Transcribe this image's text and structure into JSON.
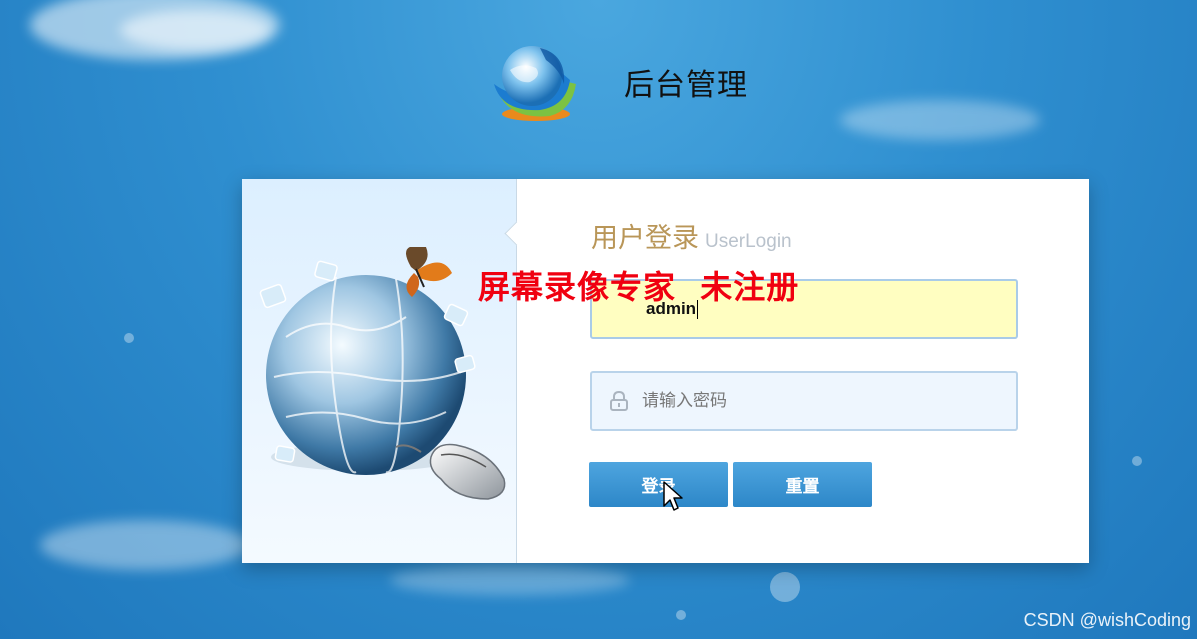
{
  "header": {
    "title": "后台管理",
    "logo_icon": "globe-logo-icon"
  },
  "login": {
    "title_zh": "用户登录",
    "title_en": "UserLogin",
    "username_value": "admin",
    "password_placeholder": "请输入密码",
    "login_label": "登录",
    "reset_label": "重置"
  },
  "overlay": {
    "watermark": "屏幕录像专家  未注册"
  },
  "footer": {
    "credit": "CSDN @wishCoding"
  },
  "colors": {
    "background": "#2f8fd0",
    "title_gold": "#b99658",
    "button_blue": "#2d87c8",
    "username_fill": "#fffec1",
    "watermark_red": "#f00010"
  },
  "icons": [
    "globe-logo-icon",
    "lock-icon",
    "puzzle-globe-illustration",
    "butterfly-icon",
    "mouse-illustration",
    "mouse-pointer-icon"
  ]
}
